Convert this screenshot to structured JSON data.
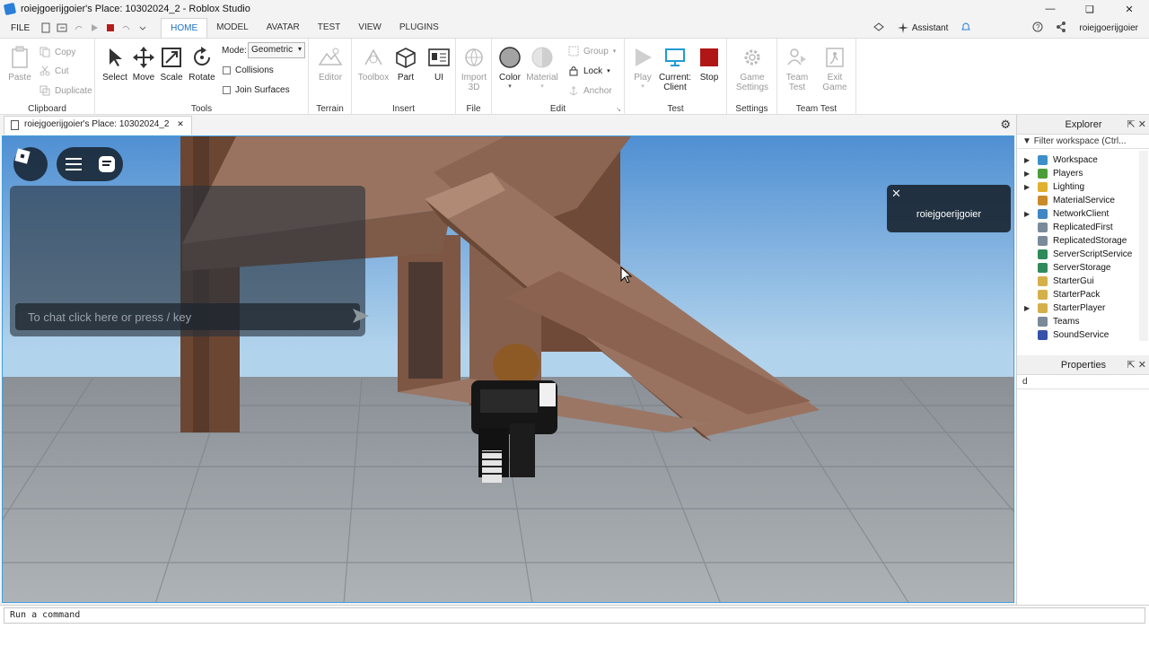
{
  "window": {
    "title": "roiejgoerijgoier's Place: 10302024_2 - Roblox Studio"
  },
  "menubar": {
    "file": "FILE",
    "tabs": [
      "HOME",
      "MODEL",
      "AVATAR",
      "TEST",
      "VIEW",
      "PLUGINS"
    ],
    "assistant": "Assistant",
    "username": "roiejgoerijgoier"
  },
  "ribbon": {
    "clipboard": {
      "paste": "Paste",
      "copy": "Copy",
      "cut": "Cut",
      "duplicate": "Duplicate",
      "group": "Clipboard"
    },
    "tools": {
      "select": "Select",
      "move": "Move",
      "scale": "Scale",
      "rotate": "Rotate",
      "mode_label": "Mode:",
      "mode_value": "Geometric",
      "collisions": "Collisions",
      "join_surfaces": "Join Surfaces",
      "group": "Tools"
    },
    "terrain": {
      "editor": "Editor",
      "group": "Terrain"
    },
    "insert": {
      "toolbox": "Toolbox",
      "part": "Part",
      "ui": "UI",
      "group": "Insert"
    },
    "file": {
      "import3d_line1": "Import",
      "import3d_line2": "3D",
      "group": "File"
    },
    "edit": {
      "color": "Color",
      "material": "Material",
      "group_btn": "Group",
      "lock": "Lock",
      "anchor": "Anchor",
      "group": "Edit"
    },
    "test": {
      "play": "Play",
      "current_line1": "Current:",
      "current_line2": "Client",
      "stop": "Stop",
      "group": "Test"
    },
    "settings": {
      "game_line1": "Game",
      "game_line2": "Settings",
      "group": "Settings"
    },
    "teamtest": {
      "team_line1": "Team",
      "team_line2": "Test",
      "exit_line1": "Exit",
      "exit_line2": "Game",
      "group": "Team Test"
    }
  },
  "doc_tab": "roiejgoerijgoier's Place: 10302024_2",
  "viewport": {
    "chat_placeholder": "To chat click here or press / key",
    "player_card_name": "roiejgoerijgoier"
  },
  "explorer": {
    "title": "Explorer",
    "filter": "Filter workspace (Ctrl...",
    "items": [
      {
        "label": "Workspace",
        "expandable": true,
        "color": "#3d8fc9"
      },
      {
        "label": "Players",
        "expandable": true,
        "color": "#4c9c3a"
      },
      {
        "label": "Lighting",
        "expandable": true,
        "color": "#e0b030"
      },
      {
        "label": "MaterialService",
        "expandable": false,
        "color": "#c98a2a"
      },
      {
        "label": "NetworkClient",
        "expandable": true,
        "color": "#3f86c2"
      },
      {
        "label": "ReplicatedFirst",
        "expandable": false,
        "color": "#7a8a9a"
      },
      {
        "label": "ReplicatedStorage",
        "expandable": false,
        "color": "#7a8a9a"
      },
      {
        "label": "ServerScriptService",
        "expandable": false,
        "color": "#2f8a5a"
      },
      {
        "label": "ServerStorage",
        "expandable": false,
        "color": "#2f8a5a"
      },
      {
        "label": "StarterGui",
        "expandable": false,
        "color": "#d4b04a"
      },
      {
        "label": "StarterPack",
        "expandable": false,
        "color": "#d4b04a"
      },
      {
        "label": "StarterPlayer",
        "expandable": true,
        "color": "#d4b04a"
      },
      {
        "label": "Teams",
        "expandable": false,
        "color": "#7a8a9a"
      },
      {
        "label": "SoundService",
        "expandable": false,
        "color": "#3552a8"
      }
    ]
  },
  "properties": {
    "title": "Properties",
    "filter": "d"
  },
  "command_bar": {
    "placeholder": "Run a command"
  }
}
